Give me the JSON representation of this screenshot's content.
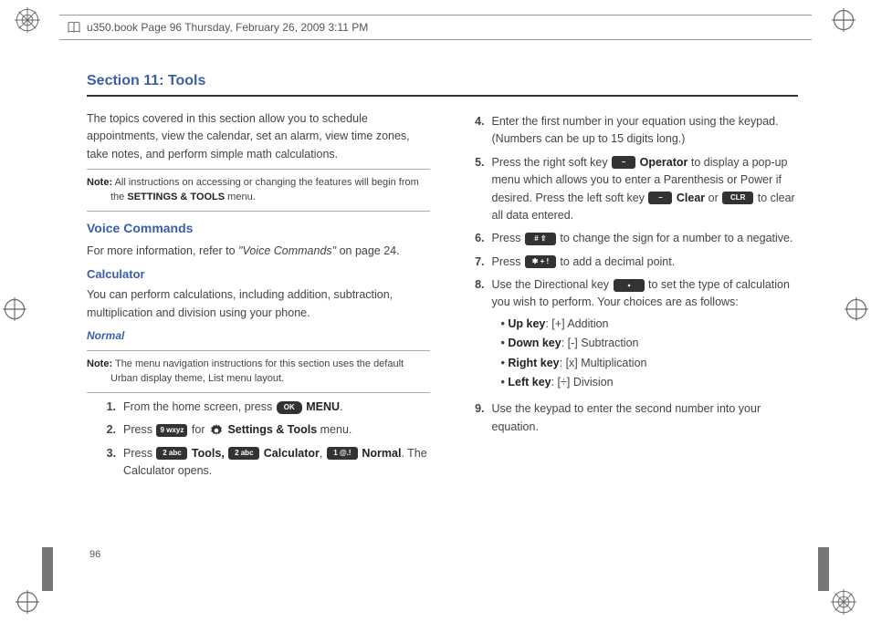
{
  "header": {
    "text": "u350.book  Page 96  Thursday, February 26, 2009  3:11 PM"
  },
  "section_title": "Section 11: Tools",
  "page_number": "96",
  "left": {
    "intro": "The topics covered in this section allow you to schedule appointments, view the calendar, set an alarm, view time zones, take notes, and perform simple math calculations.",
    "note1_label": "Note:",
    "note1_line1": "All instructions on accessing or changing the features will begin from",
    "note1_line2": "the ",
    "note1_bold": "SETTINGS & TOOLS",
    "note1_line2b": " menu.",
    "voice_h": "Voice Commands",
    "voice_p_a": "For more information, refer to ",
    "voice_ref": "\"Voice Commands\"",
    "voice_p_b": "  on page 24.",
    "calc_h": "Calculator",
    "calc_p": "You can perform calculations, including addition, subtraction, multiplication and division using your phone.",
    "normal_h": "Normal",
    "note2_label": "Note:",
    "note2_line1": "The menu navigation instructions for this section uses the default",
    "note2_line2": "Urban display theme, List menu layout.",
    "steps": {
      "s1_num": "1.",
      "s1_a": "From the home screen, press ",
      "s1_key": "OK",
      "s1_b": " ",
      "s1_bold": "MENU",
      "s1_c": ".",
      "s2_num": "2.",
      "s2_a": "Press ",
      "s2_key": "9 wxyz",
      "s2_b": " for ",
      "s2_bold": "Settings & Tools",
      "s2_c": " menu.",
      "s3_num": "3.",
      "s3_a": "Press ",
      "s3_key1": "2 abc",
      "s3_bold1": "Tools,",
      "s3_key2": "2 abc",
      "s3_bold2": "Calculator",
      "s3_mid": ", ",
      "s3_key3": "1 @.!",
      "s3_bold3": "Normal",
      "s3_end": ". The Calculator opens."
    }
  },
  "right": {
    "steps": {
      "s4_num": "4.",
      "s4": "Enter the first number in your equation using the keypad. (Numbers can be up to 15 digits long.)",
      "s5_num": "5.",
      "s5_a": "Press the right soft key ",
      "s5_key1": "–",
      "s5_bold1": "Operator",
      "s5_b": " to display a pop-up menu which allows you to enter a Parenthesis or Power if desired. Press the left soft key ",
      "s5_key2": "–",
      "s5_bold2": "Clear",
      "s5_c": " or ",
      "s5_key3": "CLR",
      "s5_d": " to clear all data entered.",
      "s6_num": "6.",
      "s6_a": "Press ",
      "s6_key": "# ⇧",
      "s6_b": " to change the sign for a number to a negative.",
      "s7_num": "7.",
      "s7_a": "Press ",
      "s7_key": "✱ + !",
      "s7_b": " to add a decimal point.",
      "s8_num": "8.",
      "s8_a": "Use the Directional key ",
      "s8_b": " to set the type of calculation you wish to perform. Your choices are as follows:",
      "bullets": {
        "b1_bold": "Up key",
        "b1": ": [+] Addition",
        "b2_bold": "Down key",
        "b2": ": [-] Subtraction",
        "b3_bold": "Right key",
        "b3": ": [x] Multiplication",
        "b4_bold": "Left key",
        "b4": ": [÷] Division"
      },
      "s9_num": "9.",
      "s9": "Use the keypad to enter the second number into your equation."
    }
  }
}
